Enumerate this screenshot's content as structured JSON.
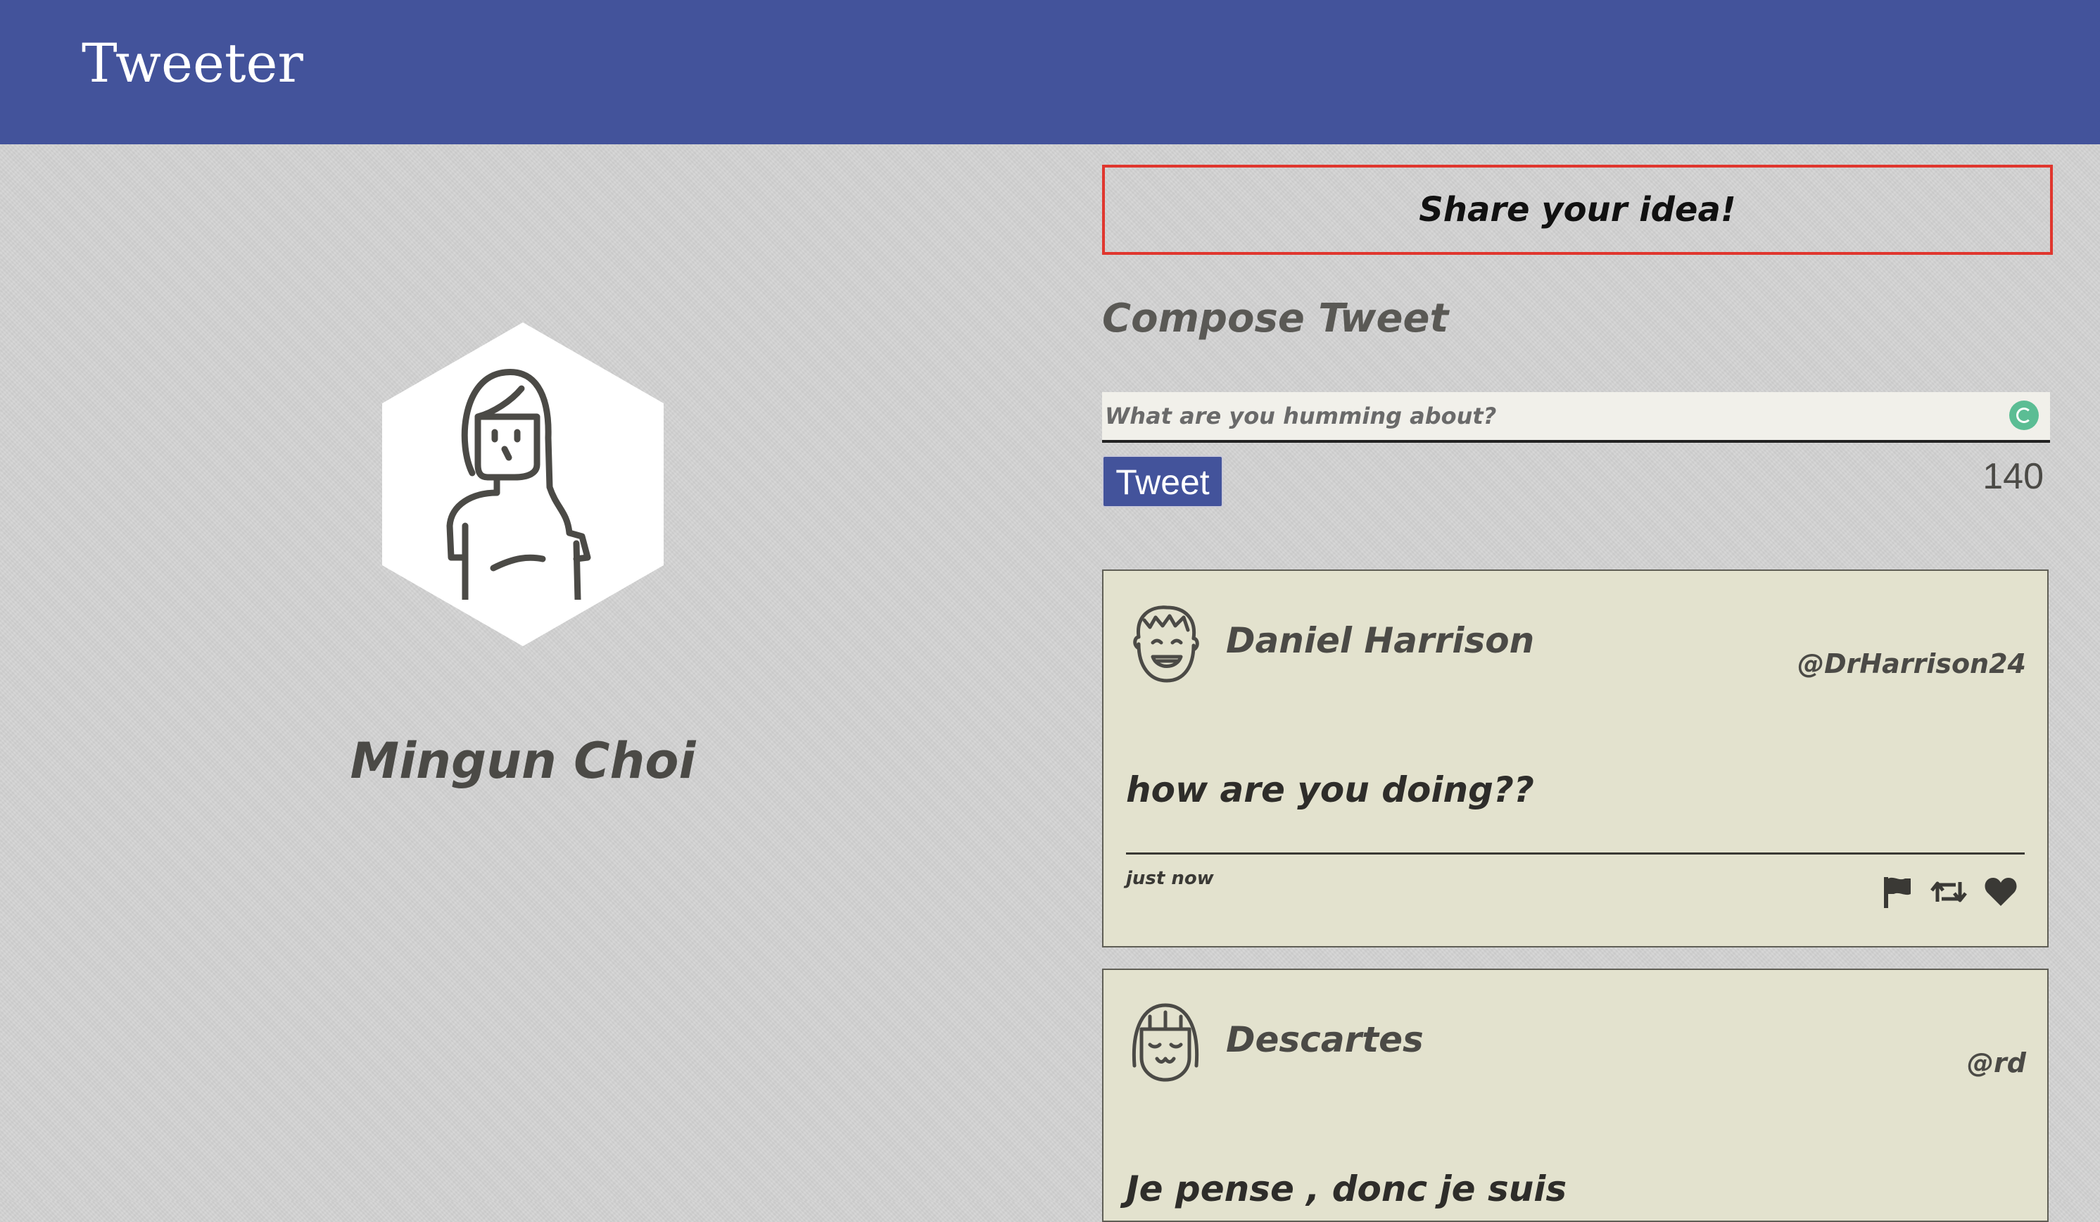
{
  "app": {
    "brand": "Tweeter",
    "accent_color": "#43539b"
  },
  "profile": {
    "name": "Mingun Choi",
    "avatar_icon": "woman-avatar-icon"
  },
  "compose": {
    "toggle_label": "Share your idea!",
    "title": "Compose Tweet",
    "placeholder": "What are you humming about?",
    "value": "",
    "submit_label": "Tweet",
    "counter": "140"
  },
  "tweets": [
    {
      "author": "Daniel Harrison",
      "handle": "@DrHarrison24",
      "content": "how are you doing??",
      "time": "just now",
      "avatar_icon": "smiling-man-avatar-icon",
      "actions": [
        "flag-icon",
        "retweet-icon",
        "heart-icon"
      ]
    },
    {
      "author": "Descartes",
      "handle": "@rd",
      "content": "Je pense , donc je suis",
      "avatar_icon": "girl-avatar-icon"
    }
  ]
}
